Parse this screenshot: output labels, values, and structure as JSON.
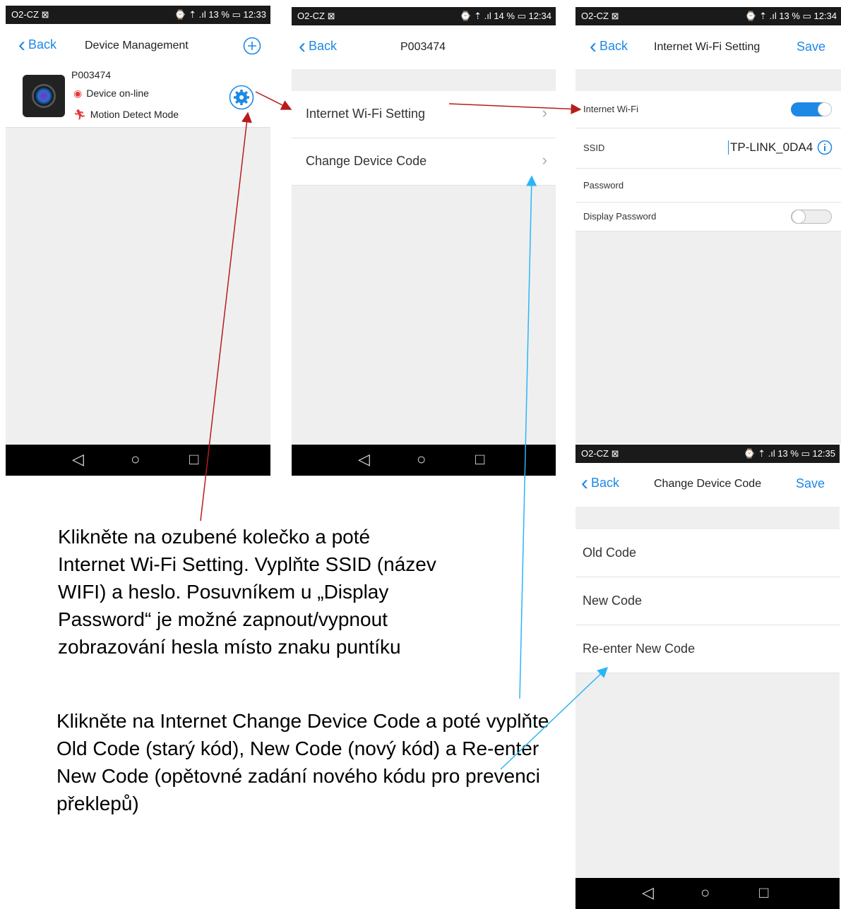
{
  "status_bars": [
    {
      "carrier": "O2-CZ ⊠",
      "right": "⌚ ⇡ .ıl 13 % ▭ 12:33"
    },
    {
      "carrier": "O2-CZ ⊠",
      "right": "⌚ ⇡ .ıl 14 % ▭ 12:34"
    },
    {
      "carrier": "O2-CZ ⊠",
      "right": "⌚ ⇡ .ıl 13 % ▭ 12:34"
    },
    {
      "carrier": "O2-CZ ⊠",
      "right": "⌚ ⇡ .ıl 13 % ▭ 12:35"
    }
  ],
  "screen1": {
    "back": "Back",
    "title": "Device Management",
    "device": {
      "name": "P003474",
      "status": "Device on-line",
      "mode": "Motion Detect Mode"
    }
  },
  "screen2": {
    "back": "Back",
    "title": "P003474",
    "items": [
      "Internet Wi-Fi Setting",
      "Change Device Code"
    ]
  },
  "screen3": {
    "back": "Back",
    "title": "Internet Wi-Fi Setting",
    "save": "Save",
    "wifi_label": "Internet Wi-Fi",
    "ssid_label": "SSID",
    "ssid_value": "TP-LINK_0DA4",
    "password_label": "Password",
    "display_password_label": "Display Password"
  },
  "screen4": {
    "back": "Back",
    "title": "Change Device Code",
    "save": "Save",
    "items": [
      "Old Code",
      "New Code",
      "Re-enter New Code"
    ]
  },
  "captions": {
    "caption1": "Klikněte na ozubené kolečko a poté Internet Wi-Fi Setting. Vyplňte SSID (název WIFI) a heslo. Posuvníkem u „Display Password“ je možné zapnout/vypnout zobrazování hesla místo znaku puntíku",
    "caption2": "Klikněte na Internet Change Device Code a poté vyplňte Old Code (starý kód), New Code (nový kód) a Re-enter New Code (opětovné zadání nového kódu pro prevenci překlepů)"
  },
  "colors": {
    "accent": "#1e88e5",
    "arrow_red": "#b71c1c",
    "arrow_blue": "#29b6f6"
  }
}
